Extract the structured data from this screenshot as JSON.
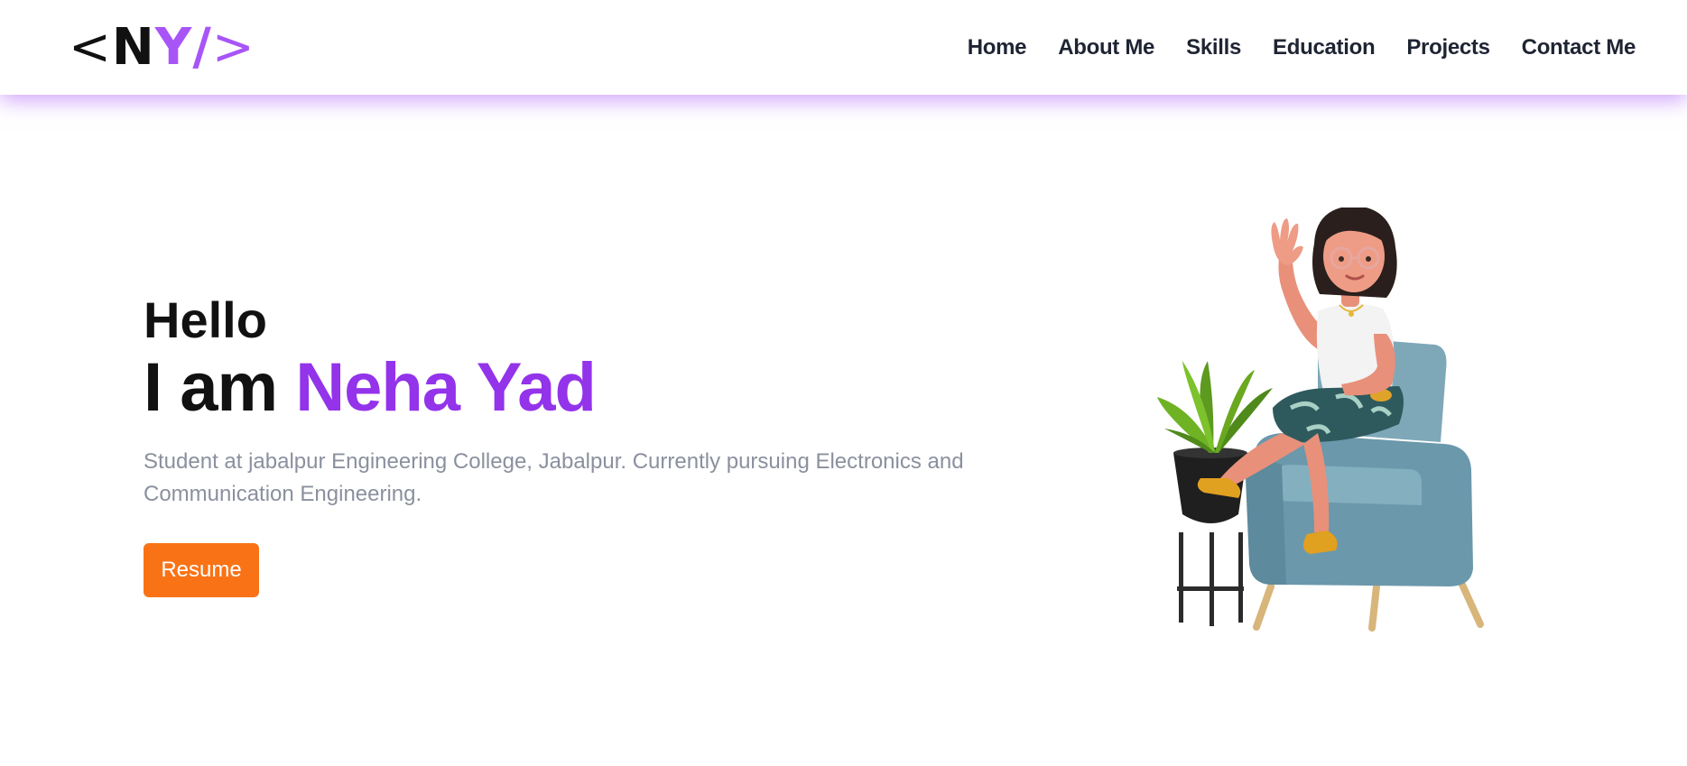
{
  "logo": {
    "lt": "<",
    "n": "N",
    "y": "Y",
    "slash": "/",
    "gt": ">"
  },
  "nav": {
    "items": [
      {
        "label": "Home"
      },
      {
        "label": "About Me"
      },
      {
        "label": "Skills"
      },
      {
        "label": "Education"
      },
      {
        "label": "Projects"
      },
      {
        "label": "Contact Me"
      }
    ]
  },
  "hero": {
    "greeting": "Hello",
    "intro_prefix": "I am ",
    "name": "Neha Yad",
    "description": "Student at jabalpur Engineering College, Jabalpur. Currently pursuing Electronics and Communication Engineering.",
    "resume_label": "Resume"
  },
  "colors": {
    "accent_purple": "#9333ea",
    "logo_purple": "#a855f7",
    "button_orange": "#f97316",
    "nav_text": "#1f2433",
    "description_text": "#8b909e"
  },
  "icons": {
    "illustration": "girl-waving-on-armchair-illustration"
  }
}
